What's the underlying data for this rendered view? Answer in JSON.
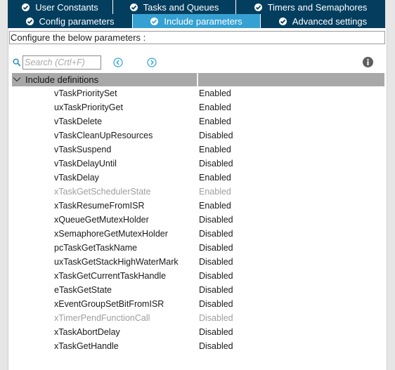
{
  "tabs_row1": [
    {
      "label": "User Constants"
    },
    {
      "label": "Tasks and Queues"
    },
    {
      "label": "Timers and Semaphores"
    }
  ],
  "tabs_row2": [
    {
      "label": "Config parameters",
      "active": false
    },
    {
      "label": "Include parameters",
      "active": true
    },
    {
      "label": "Advanced settings",
      "active": false
    }
  ],
  "config_text": "Configure the below parameters :",
  "search": {
    "placeholder": "Search (Crtl+F)"
  },
  "icons": {
    "search": "search-icon",
    "prev": "chevron-left-circle-icon",
    "next": "chevron-right-circle-icon",
    "info": "info-icon"
  },
  "colors": {
    "tab_bg": "#033e5e",
    "tab_active_bg": "#35a0d2",
    "nav_accent": "#2aa3d6",
    "group_header_bg": "#a8a8a8"
  },
  "group": {
    "title": "Include definitions"
  },
  "rows": [
    {
      "name": "vTaskPrioritySet",
      "value": "Enabled",
      "disabled": false
    },
    {
      "name": "uxTaskPriorityGet",
      "value": "Enabled",
      "disabled": false
    },
    {
      "name": "vTaskDelete",
      "value": "Enabled",
      "disabled": false
    },
    {
      "name": "vTaskCleanUpResources",
      "value": "Disabled",
      "disabled": false
    },
    {
      "name": "vTaskSuspend",
      "value": "Enabled",
      "disabled": false
    },
    {
      "name": "vTaskDelayUntil",
      "value": "Disabled",
      "disabled": false
    },
    {
      "name": "vTaskDelay",
      "value": "Enabled",
      "disabled": false
    },
    {
      "name": "xTaskGetSchedulerState",
      "value": "Enabled",
      "disabled": true
    },
    {
      "name": "xTaskResumeFromISR",
      "value": "Enabled",
      "disabled": false
    },
    {
      "name": "xQueueGetMutexHolder",
      "value": "Disabled",
      "disabled": false
    },
    {
      "name": "xSemaphoreGetMutexHolder",
      "value": "Disabled",
      "disabled": false
    },
    {
      "name": "pcTaskGetTaskName",
      "value": "Disabled",
      "disabled": false
    },
    {
      "name": "uxTaskGetStackHighWaterMark",
      "value": "Disabled",
      "disabled": false
    },
    {
      "name": "xTaskGetCurrentTaskHandle",
      "value": "Disabled",
      "disabled": false
    },
    {
      "name": "eTaskGetState",
      "value": "Disabled",
      "disabled": false
    },
    {
      "name": "xEventGroupSetBitFromISR",
      "value": "Disabled",
      "disabled": false
    },
    {
      "name": "xTimerPendFunctionCall",
      "value": "Disabled",
      "disabled": true
    },
    {
      "name": "xTaskAbortDelay",
      "value": "Disabled",
      "disabled": false
    },
    {
      "name": "xTaskGetHandle",
      "value": "Disabled",
      "disabled": false
    }
  ]
}
